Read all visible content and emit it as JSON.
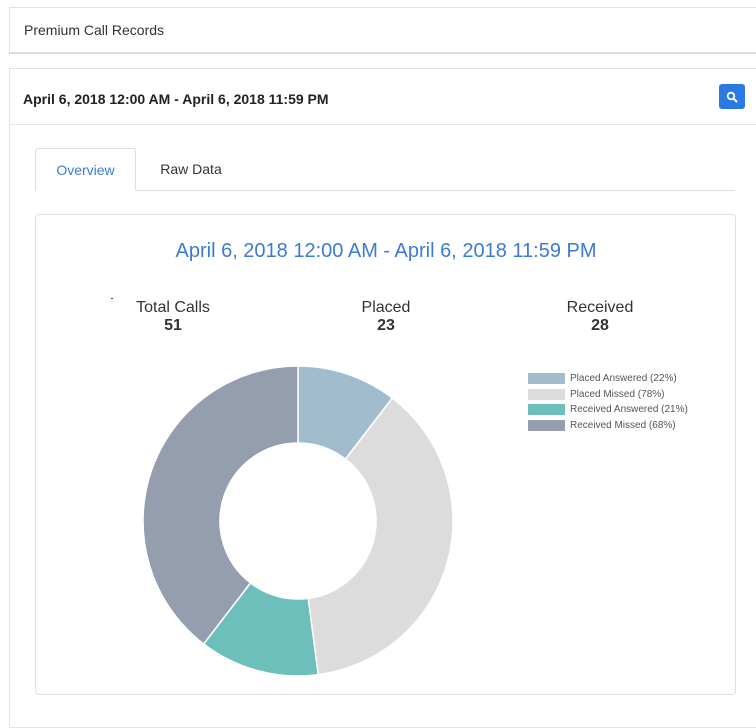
{
  "header": {
    "title": "Premium Call Records"
  },
  "date_range": {
    "label": "April 6, 2018 12:00 AM - April 6, 2018 11:59 PM",
    "search_icon": "search-icon"
  },
  "tabs": [
    {
      "label": "Overview",
      "active": true
    },
    {
      "label": "Raw Data",
      "active": false
    }
  ],
  "card": {
    "title": "April 6, 2018 12:00 AM - April 6, 2018 11:59 PM",
    "stats": {
      "total_label": "Total Calls",
      "total_value": "51",
      "placed_label": "Placed",
      "placed_value": "23",
      "received_label": "Received",
      "received_value": "28"
    }
  },
  "colors": {
    "accent": "#2a7ae2",
    "title_blue": "#3c7bd4"
  },
  "chart_data": {
    "type": "pie",
    "donut": true,
    "categories": [
      "Placed Answered (22%)",
      "Placed Missed (78%)",
      "Received Answered (21%)",
      "Received Missed (68%)"
    ],
    "values": [
      5,
      18,
      6,
      19
    ],
    "colors": [
      "#a0bccd",
      "#dcdcdc",
      "#6cbfbb",
      "#959eae"
    ],
    "legend_position": "right"
  }
}
